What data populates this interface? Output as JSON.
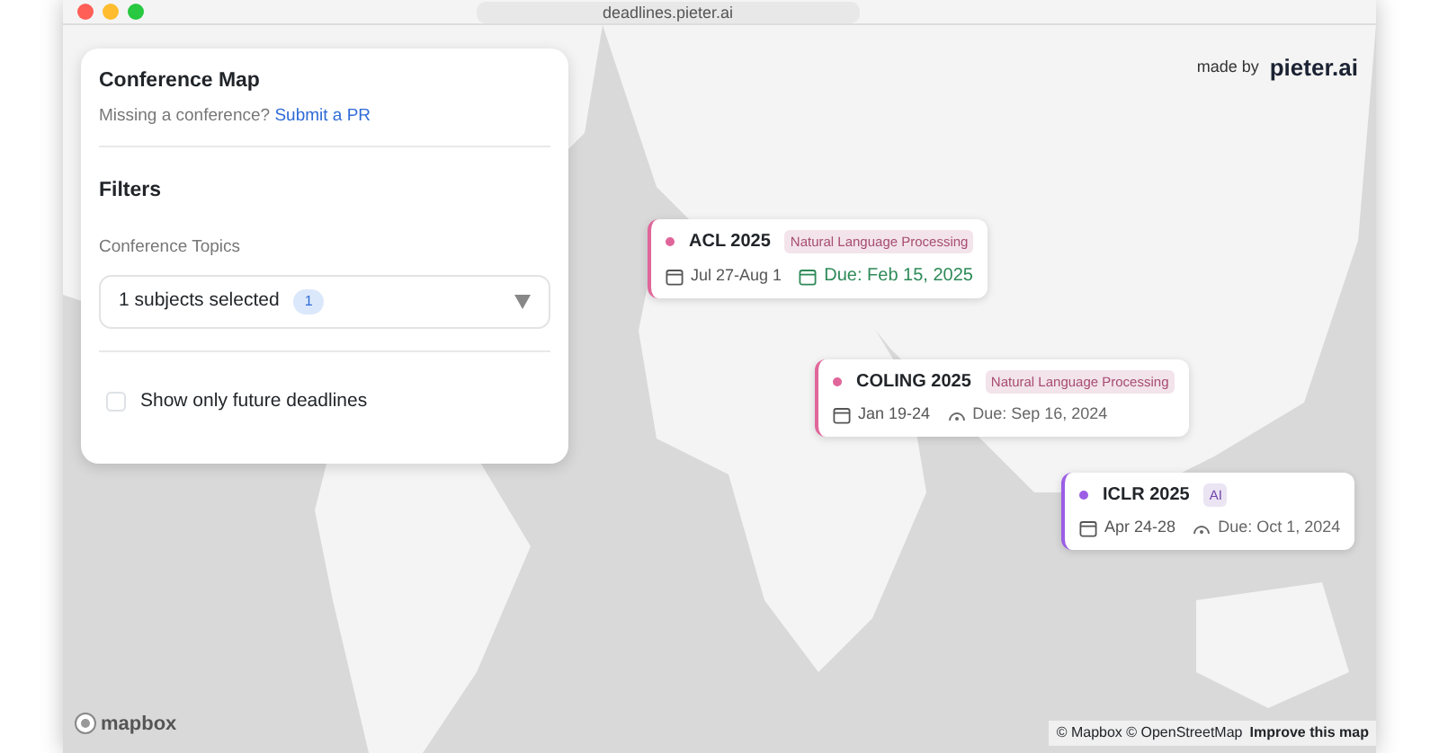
{
  "browser": {
    "url": "deadlines.pieter.ai"
  },
  "panel": {
    "title": "Conference Map",
    "missing_text": "Missing a conference?",
    "missing_link": "Submit a PR",
    "filters_heading": "Filters",
    "topics_label": "Conference Topics",
    "topics_select": {
      "value": "1 subjects selected",
      "count": "1"
    },
    "future_only": {
      "label": "Show only future deadlines",
      "checked": false
    }
  },
  "made_by": {
    "text": "made by",
    "brand": "pieter.ai"
  },
  "conferences": [
    {
      "name": "ACL 2025",
      "topic": "Natural Language Processing",
      "color": "#e0669a",
      "dates": "Jul 27-Aug 1",
      "due": "Due: Feb 15, 2025",
      "due_passed": false
    },
    {
      "name": "COLING 2025",
      "topic": "Natural Language Processing",
      "color": "#e0669a",
      "dates": "Jan 19-24",
      "due": "Due: Sep 16, 2024",
      "due_passed": true
    },
    {
      "name": "ICLR 2025",
      "topic": "AI",
      "color": "#9b5de5",
      "dates": "Apr 24-28",
      "due": "Due: Oct 1, 2024",
      "due_passed": true
    }
  ],
  "attribution": {
    "logo": "mapbox",
    "credits": "© Mapbox © OpenStreetMap",
    "improve": "Improve this map"
  }
}
